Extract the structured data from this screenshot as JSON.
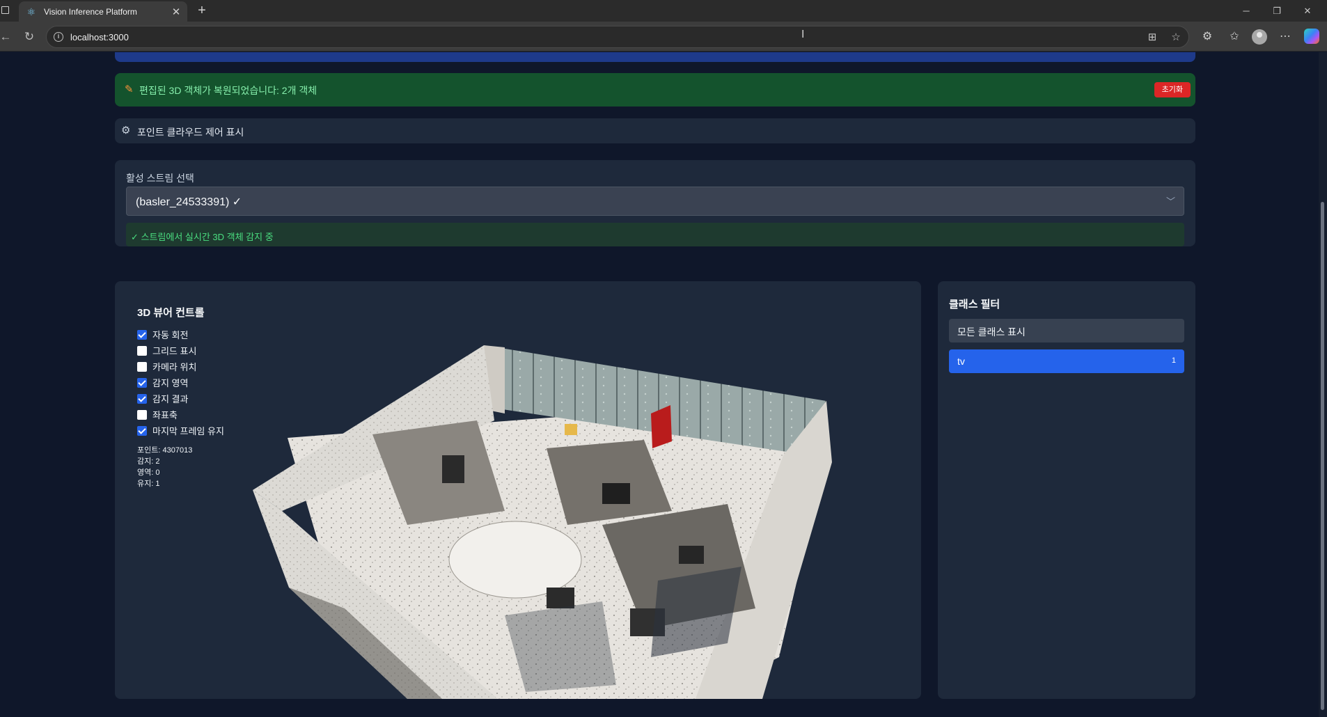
{
  "browser": {
    "tab_title": "Vision Inference Platform",
    "url": "localhost:3000"
  },
  "banner": {
    "message": "편집된 3D 객체가 복원되었습니다: 2개 객체",
    "reset_label": "초기화"
  },
  "pointcloud_toggle": {
    "label": "포인트 클라우드 제어 표시"
  },
  "stream": {
    "title": "활성 스트림 선택",
    "selected": "(basler_24533391) ✓",
    "status": "✓ 스트림에서 실시간 3D 객체 감지 중"
  },
  "viewer": {
    "title": "3D 뷰어 컨트롤",
    "options": [
      {
        "label": "자동 회전",
        "checked": true
      },
      {
        "label": "그리드 표시",
        "checked": false
      },
      {
        "label": "카메라 위치",
        "checked": false
      },
      {
        "label": "감지 영역",
        "checked": true
      },
      {
        "label": "감지 결과",
        "checked": true
      },
      {
        "label": "좌표축",
        "checked": false
      },
      {
        "label": "마지막 프레임 유지",
        "checked": true
      }
    ],
    "stats": {
      "points_label": "포인트:",
      "points": "4307013",
      "detections_label": "감지:",
      "detections": "2",
      "regions_label": "영역:",
      "regions": "0",
      "kept_label": "유지:",
      "kept": "1"
    }
  },
  "class_filter": {
    "title": "클래스 필터",
    "all_label": "모든 클래스 표시",
    "items": [
      {
        "name": "tv",
        "count": "1"
      }
    ]
  },
  "colors": {
    "page_bg": "#0f172a",
    "card_bg": "#1e293b",
    "success_bg": "#14532d",
    "success_text": "#86efac",
    "danger": "#dc2626",
    "accent": "#2563eb"
  }
}
